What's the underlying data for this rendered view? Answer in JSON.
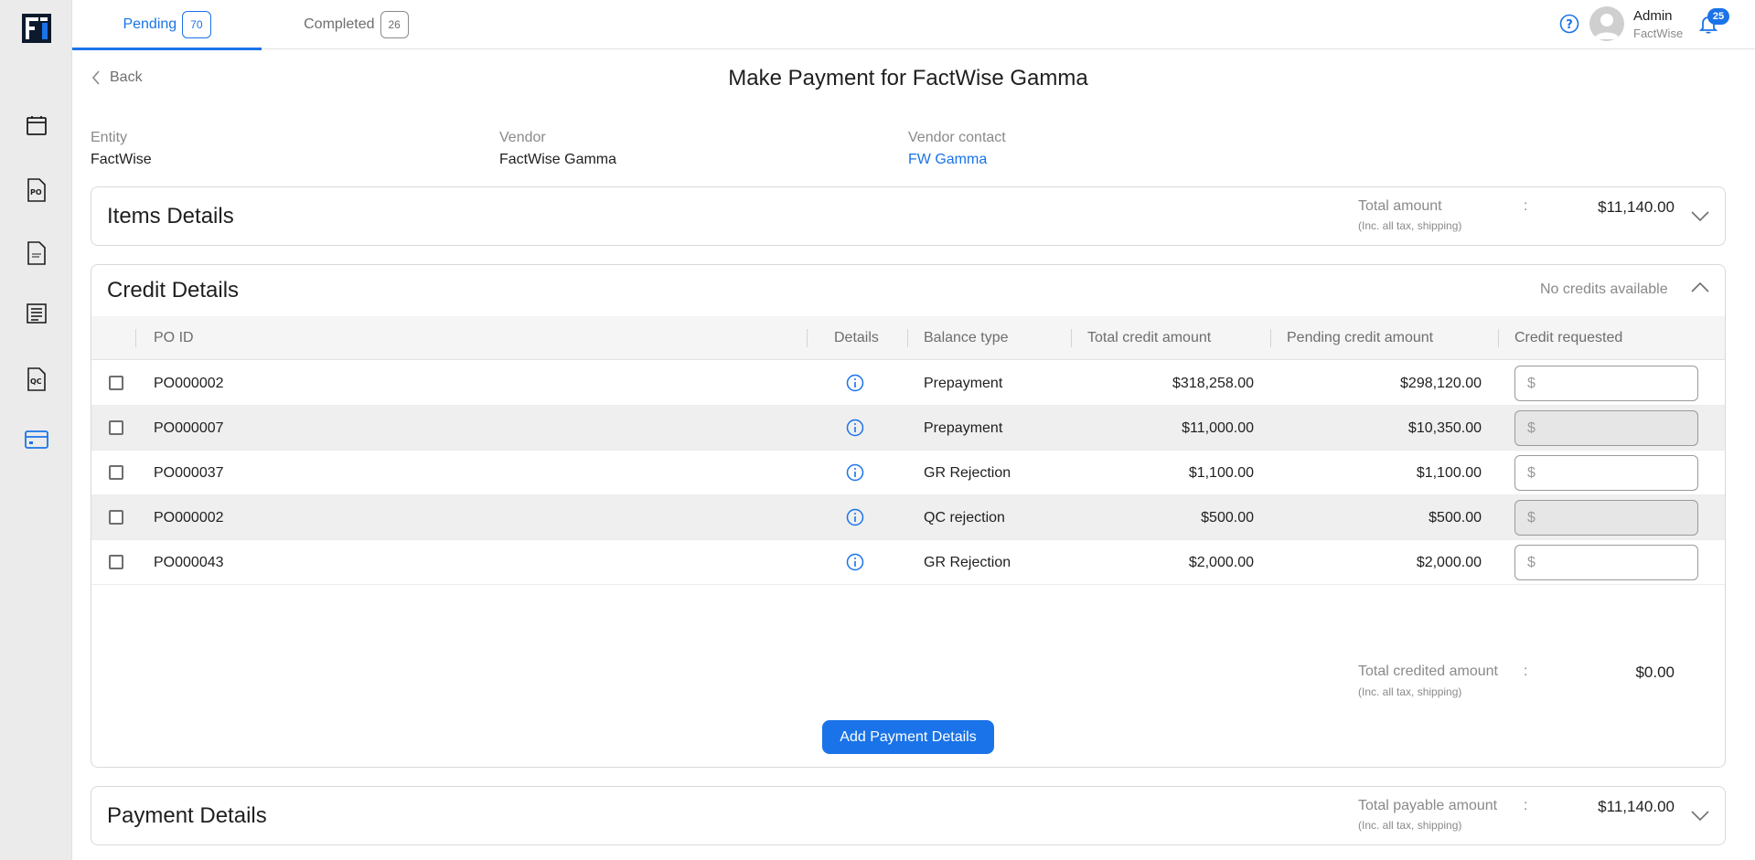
{
  "tabs": [
    {
      "label": "Pending",
      "count": "70"
    },
    {
      "label": "Completed",
      "count": "26"
    }
  ],
  "user": {
    "name": "Admin",
    "org": "FactWise",
    "notifications": "25"
  },
  "header": {
    "back_label": "Back",
    "title": "Make Payment for FactWise Gamma"
  },
  "meta": {
    "entity_label": "Entity",
    "entity_value": "FactWise",
    "vendor_label": "Vendor",
    "vendor_value": "FactWise Gamma",
    "contact_label": "Vendor contact",
    "contact_value": "FW Gamma"
  },
  "items_panel": {
    "title": "Items Details",
    "amount_label": "Total amount",
    "amount_sub": "(Inc. all tax, shipping)",
    "colon": ":",
    "amount_value": "$11,140.00"
  },
  "credit_panel": {
    "title": "Credit Details",
    "status": "No credits available",
    "columns": {
      "po_id": "PO ID",
      "details": "Details",
      "balance_type": "Balance type",
      "total_credit": "Total credit amount",
      "pending_credit": "Pending credit amount",
      "credit_requested": "Credit requested"
    },
    "rows": [
      {
        "po_id": "PO000002",
        "balance_type": "Prepayment",
        "total": "$318,258.00",
        "pending": "$298,120.00",
        "currency": "$"
      },
      {
        "po_id": "PO000007",
        "balance_type": "Prepayment",
        "total": "$11,000.00",
        "pending": "$10,350.00",
        "currency": "$"
      },
      {
        "po_id": "PO000037",
        "balance_type": "GR Rejection",
        "total": "$1,100.00",
        "pending": "$1,100.00",
        "currency": "$"
      },
      {
        "po_id": "PO000002",
        "balance_type": "QC rejection",
        "total": "$500.00",
        "pending": "$500.00",
        "currency": "$"
      },
      {
        "po_id": "PO000043",
        "balance_type": "GR Rejection",
        "total": "$2,000.00",
        "pending": "$2,000.00",
        "currency": "$"
      }
    ],
    "total_label": "Total credited amount",
    "total_sub": "(Inc. all tax, shipping)",
    "colon": ":",
    "total_value": "$0.00",
    "button_label": "Add Payment Details"
  },
  "payment_panel": {
    "title": "Payment Details",
    "amount_label": "Total payable amount",
    "amount_sub": "(Inc. all tax, shipping)",
    "colon": ":",
    "amount_value": "$11,140.00"
  },
  "colors": {
    "accent": "#1a73e8",
    "sidebar": "#ebebeb",
    "row_alt": "#efeff0"
  }
}
